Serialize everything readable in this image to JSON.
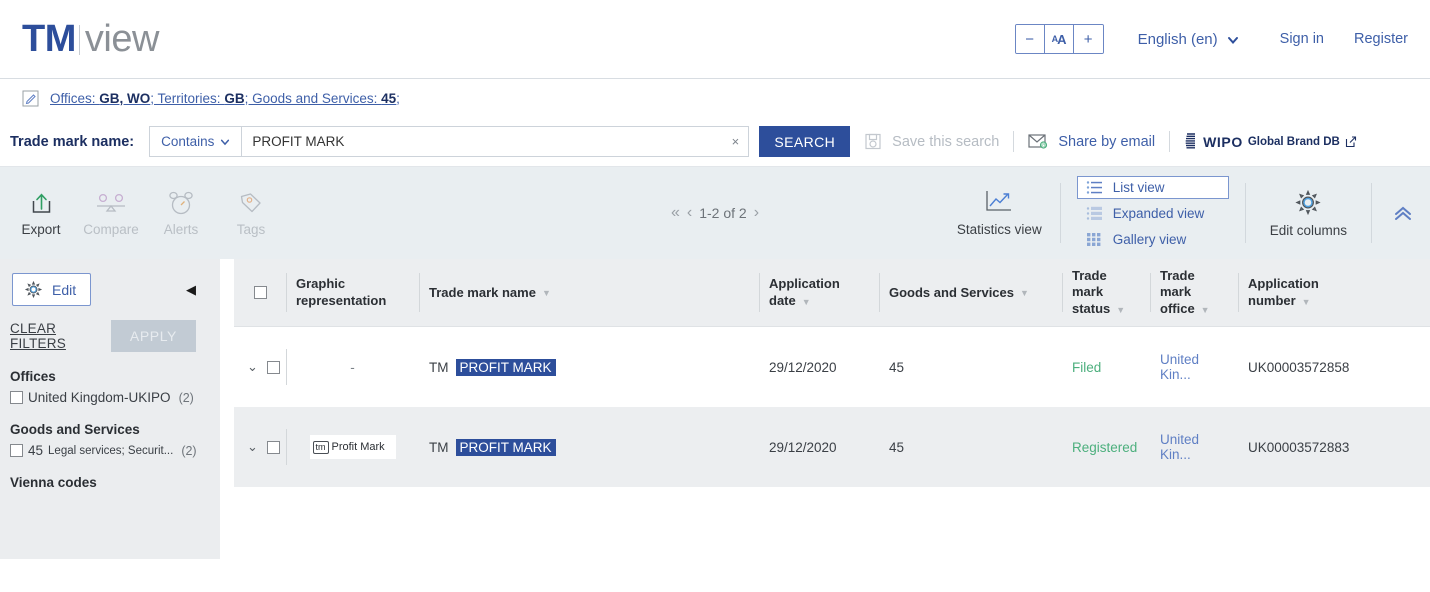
{
  "header": {
    "logo_tm": "TM",
    "logo_view": "view",
    "fontsize": {
      "decrease": "−",
      "reset": "A",
      "reset_small": "A",
      "increase": "+"
    },
    "language": "English (en)",
    "sign_in": "Sign in",
    "register": "Register"
  },
  "breadcrumb": {
    "prefix_offices": "Offices: ",
    "offices_value": "GB, WO",
    "sep1": "; Territories: ",
    "territories_value": "GB",
    "sep2": "; Goods and Services: ",
    "goods_value": "45",
    "sep3": ";"
  },
  "search": {
    "label": "Trade mark name:",
    "operator": "Contains",
    "value": "PROFIT MARK",
    "placeholder": "",
    "clear": "×",
    "button": "SEARCH",
    "save_search": "Save this search",
    "share_email": "Share by email",
    "wipo_word": "WIPO",
    "wipo_sub": "Global Brand DB"
  },
  "toolbar": {
    "export": "Export",
    "compare": "Compare",
    "alerts": "Alerts",
    "tags": "Tags",
    "pagination": {
      "first": "«",
      "prev": "‹",
      "range": "1-2 of 2",
      "next": "›"
    },
    "statistics_view": "Statistics view",
    "view_modes": [
      {
        "label": "List view",
        "selected": true
      },
      {
        "label": "Expanded view",
        "selected": false
      },
      {
        "label": "Gallery view",
        "selected": false
      }
    ],
    "edit_columns": "Edit columns",
    "collapse": "⌃"
  },
  "sidebar": {
    "edit": "Edit",
    "collapse": "◀",
    "clear_filters": "CLEAR FILTERS",
    "apply": "APPLY",
    "facets": [
      {
        "title": "Offices",
        "options": [
          {
            "label": "United Kingdom-UKIPO",
            "count": "(2)",
            "small": ""
          }
        ]
      },
      {
        "title": "Goods and Services",
        "options": [
          {
            "label": "45",
            "small": "Legal services; Securit...",
            "count": "(2)"
          }
        ]
      },
      {
        "title": "Vienna codes",
        "options": []
      }
    ]
  },
  "table": {
    "columns": [
      {
        "key": "checkbox",
        "label": ""
      },
      {
        "key": "graphic",
        "label": "Graphic representation",
        "line1": "Graphic",
        "line2": "representation"
      },
      {
        "key": "name",
        "label": "Trade mark name",
        "sortable": true
      },
      {
        "key": "appdate",
        "label": "Application date",
        "line1": "Application",
        "line2": "date",
        "sortable": true
      },
      {
        "key": "goods",
        "label": "Goods and Services",
        "sortable": true
      },
      {
        "key": "status",
        "label": "Trade mark status",
        "line1": "Trade",
        "line2": "mark",
        "line3": "status",
        "sortable": true
      },
      {
        "key": "office",
        "label": "Trade mark office",
        "line1": "Trade",
        "line2": "mark",
        "line3": "office",
        "sortable": true
      },
      {
        "key": "appnum",
        "label": "Application number",
        "line1": "Application",
        "line2": "number",
        "sortable": true
      }
    ],
    "rows": [
      {
        "graphic": "-",
        "graphic_type": "none",
        "tm_prefix": "TM",
        "name": "PROFIT MARK",
        "application_date": "29/12/2020",
        "goods_and_services": "45",
        "status": "Filed",
        "office": "United Kin...",
        "application_number": "UK00003572858"
      },
      {
        "graphic": "Profit Mark",
        "graphic_type": "image",
        "graphic_badge": "tm",
        "tm_prefix": "TM",
        "name": "PROFIT MARK",
        "application_date": "29/12/2020",
        "goods_and_services": "45",
        "status": "Registered",
        "office": "United Kin...",
        "application_number": "UK00003572883"
      }
    ]
  },
  "colors": {
    "brand_blue": "#2d4e9b",
    "link_blue": "#3e5fa8",
    "status_green": "#4caf7d",
    "toolbar_bg": "#e9eef1",
    "sidebar_bg": "#ebedef"
  }
}
